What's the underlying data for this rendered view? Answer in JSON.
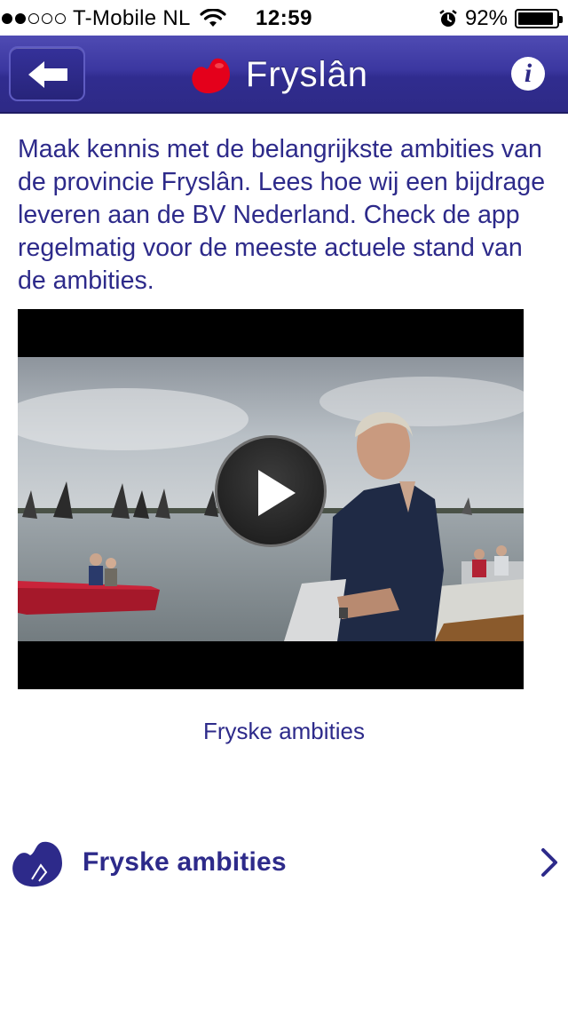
{
  "status_bar": {
    "carrier": "T-Mobile NL",
    "time": "12:59",
    "battery_percent": "92%",
    "battery_level": 0.92,
    "signal_strength": 2
  },
  "navbar": {
    "title": "Fryslân",
    "back_icon": "arrow-left-icon",
    "info_label": "i"
  },
  "content": {
    "intro": "Maak kennis met de belangrijkste ambities van de provincie Fryslân. Lees hoe wij een bijdrage leveren aan de BV Nederland. Check de app regelmatig voor de meeste actuele stand van de ambities.",
    "video_caption": "Fryske ambities"
  },
  "list": {
    "items": [
      {
        "label": "Fryske ambities",
        "icon": "fryslan-heart-icon"
      }
    ]
  },
  "colors": {
    "brand_blue": "#2d2a8a",
    "nav_blue": "#3b37a0",
    "heart_red": "#e4001b"
  }
}
